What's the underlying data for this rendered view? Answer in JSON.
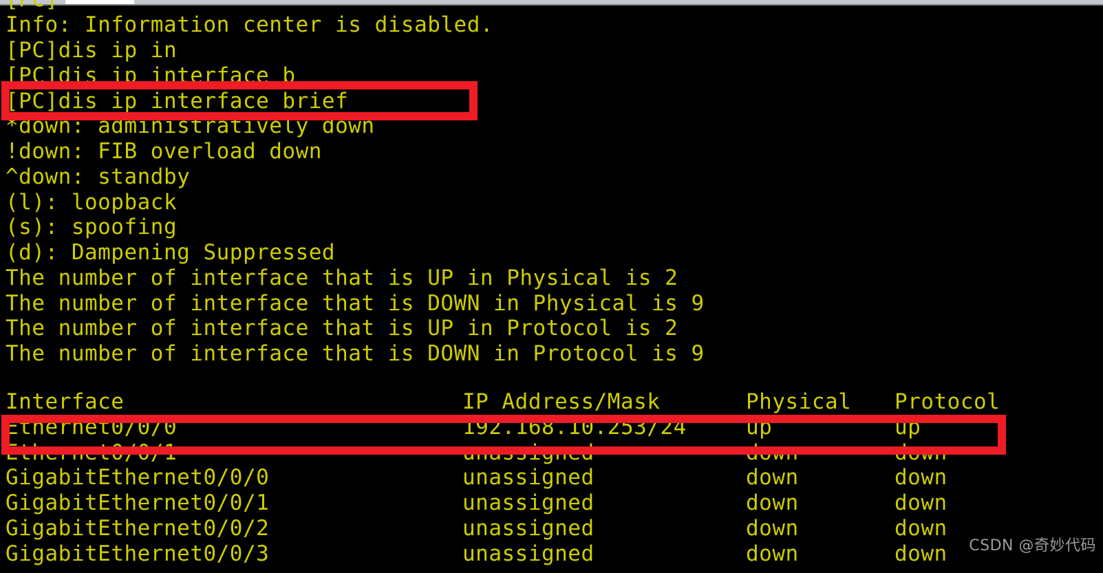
{
  "window": {
    "chrome_visible": true,
    "background_color": "#000000",
    "text_color": "#cdcd00",
    "highlight_color": "#ee1c25",
    "border_color": "#39424e"
  },
  "terminal": {
    "clipped_top_line": "[PC]",
    "lines": [
      "Info: Information center is disabled.",
      "[PC]dis ip in",
      "[PC]dis ip interface b",
      "[PC]dis ip interface brief",
      "*down: administratively down",
      "!down: FIB overload down",
      "^down: standby",
      "(l): loopback",
      "(s): spoofing",
      "(d): Dampening Suppressed",
      "The number of interface that is UP in Physical is 2",
      "The number of interface that is DOWN in Physical is 9",
      "The number of interface that is UP in Protocol is 2",
      "The number of interface that is DOWN in Protocol is 9",
      ""
    ]
  },
  "interface_table": {
    "headers": {
      "interface": "Interface",
      "ip_address_mask": "IP Address/Mask",
      "physical": "Physical",
      "protocol": "Protocol"
    },
    "rows": [
      {
        "interface": "Ethernet0/0/0",
        "ip_address_mask": "192.168.10.253/24",
        "physical": "up",
        "protocol": "up"
      },
      {
        "interface": "Ethernet0/0/1",
        "ip_address_mask": "unassigned",
        "physical": "down",
        "protocol": "down"
      },
      {
        "interface": "GigabitEthernet0/0/0",
        "ip_address_mask": "unassigned",
        "physical": "down",
        "protocol": "down"
      },
      {
        "interface": "GigabitEthernet0/0/1",
        "ip_address_mask": "unassigned",
        "physical": "down",
        "protocol": "down"
      },
      {
        "interface": "GigabitEthernet0/0/2",
        "ip_address_mask": "unassigned",
        "physical": "down",
        "protocol": "down"
      },
      {
        "interface": "GigabitEthernet0/0/3",
        "ip_address_mask": "unassigned",
        "physical": "down",
        "protocol": "down"
      }
    ]
  },
  "annotations": {
    "command_box_target": "[PC]dis ip interface brief",
    "row_box_target": "Ethernet0/0/0"
  },
  "watermark": {
    "text": "CSDN @奇妙代码"
  }
}
